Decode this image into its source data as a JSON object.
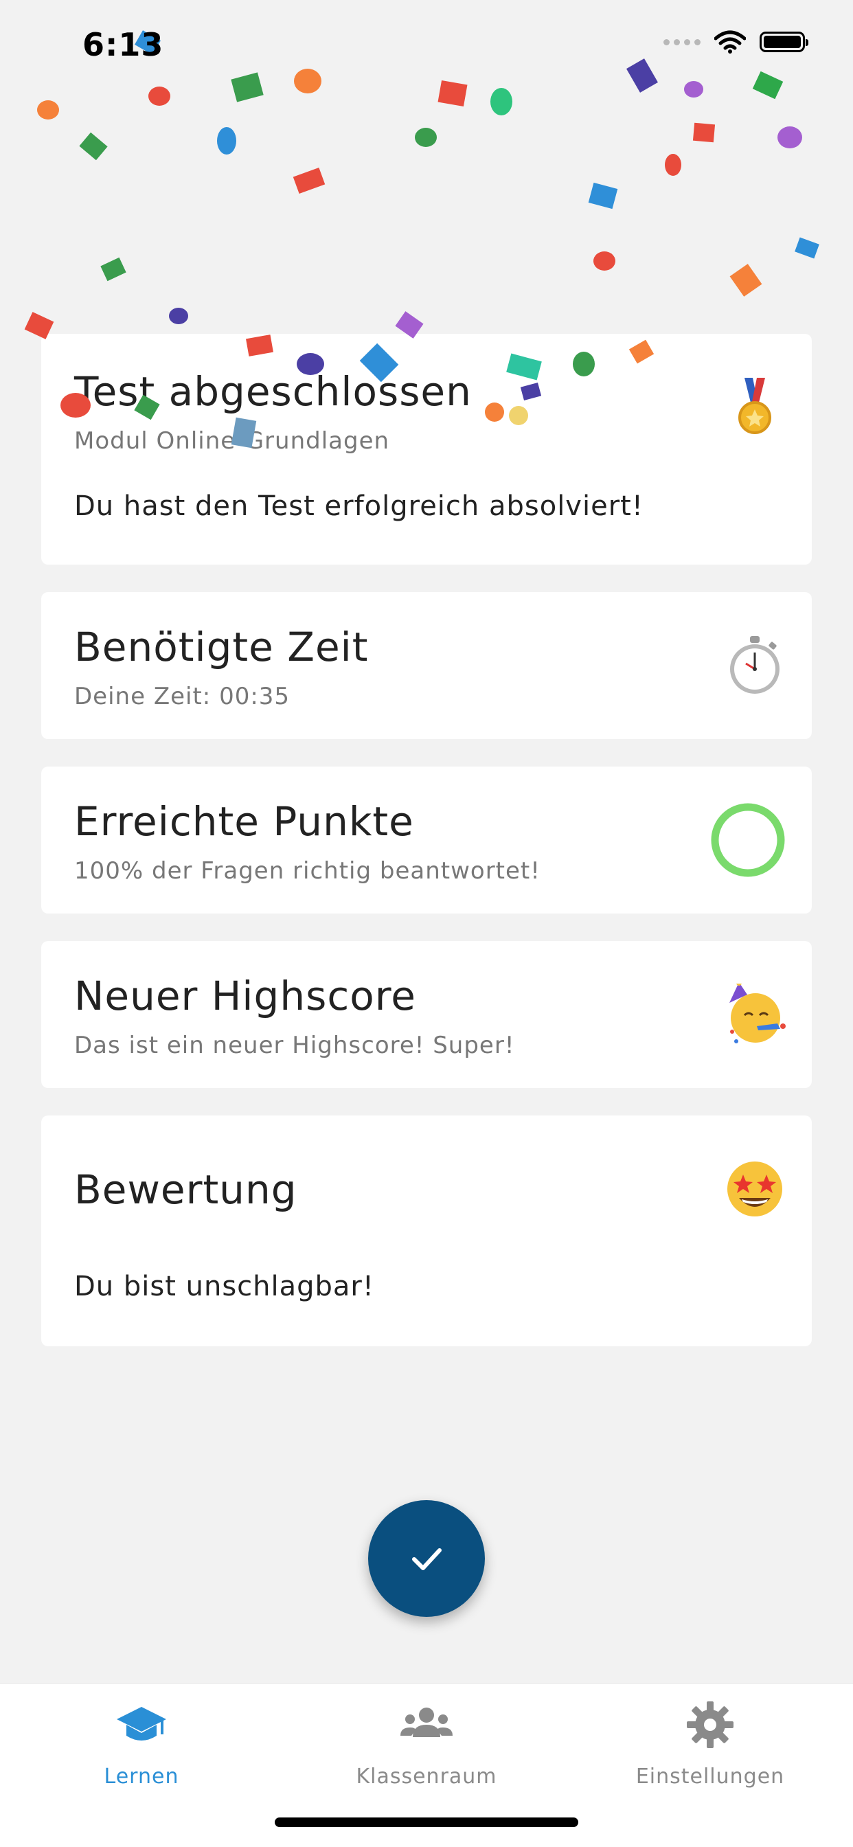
{
  "status_bar": {
    "time": "6:13"
  },
  "cards": [
    {
      "title": "Test abgeschlossen",
      "subtitle": "Modul Online-Grundlagen",
      "body": "Du hast den Test erfolgreich absolviert!",
      "icon": "medal-icon"
    },
    {
      "title": "Benötigte Zeit",
      "subtitle": "Deine Zeit: 00:35",
      "icon": "stopwatch-icon"
    },
    {
      "title": "Erreichte Punkte",
      "subtitle": "100% der Fragen richtig beantwortet!",
      "icon": "progress-ring-icon",
      "progress": 1.0,
      "progress_color": "#7ada6c"
    },
    {
      "title": "Neuer Highscore",
      "subtitle": "Das ist ein neuer Highscore! Super!",
      "icon": "party-face-icon"
    },
    {
      "title": "Bewertung",
      "body": "Du bist unschlagbar!",
      "icon": "star-struck-face-icon"
    }
  ],
  "fab": {
    "icon": "checkmark-icon",
    "color": "#0a4f7f"
  },
  "bottom_nav": {
    "items": [
      {
        "label": "Lernen",
        "icon": "graduation-cap-icon",
        "active": true
      },
      {
        "label": "Klassenraum",
        "icon": "group-icon",
        "active": false
      },
      {
        "label": "Einstellungen",
        "icon": "gear-icon",
        "active": false
      }
    ],
    "active_color": "#2a8fd6",
    "inactive_color": "#8a8a8a"
  }
}
